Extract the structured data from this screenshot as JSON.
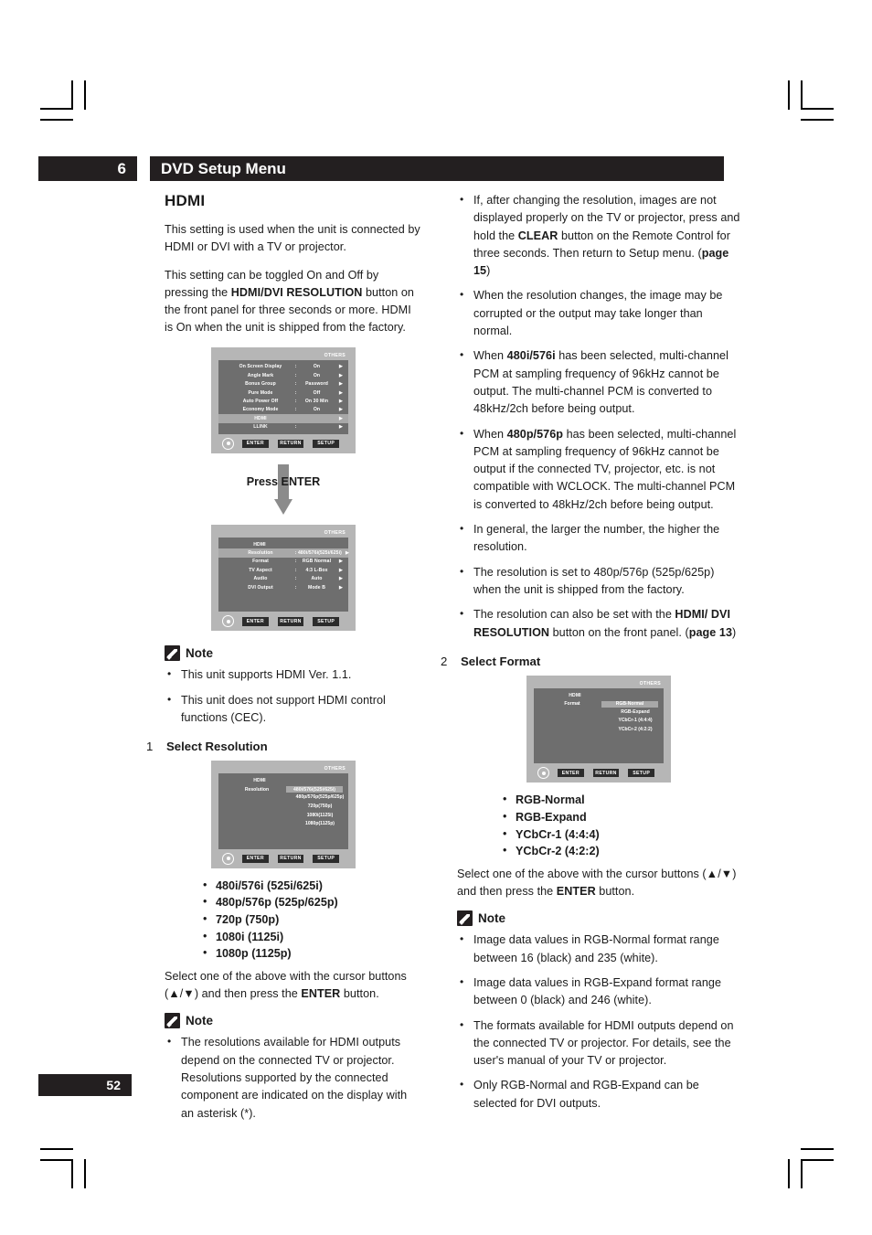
{
  "header": {
    "chapter_number": "6",
    "chapter_title": "DVD Setup Menu"
  },
  "page_number": "52",
  "left_column": {
    "section_title": "HDMI",
    "paragraph_1": "This setting is used when the unit is connected by HDMI or DVI with a TV or projector.",
    "paragraph_2_pre": "This setting can be toggled On and Off by pressing the ",
    "paragraph_2_bold": "HDMI/DVI RESOLUTION",
    "paragraph_2_post": " button on the front panel for three seconds or more. HDMI is On when the unit is shipped from the factory.",
    "osd_others_label": "OTHERS",
    "osd_main": {
      "rows": [
        {
          "label": "On Screen Display",
          "value": "On"
        },
        {
          "label": "Angle Mark",
          "value": "On"
        },
        {
          "label": "Bonus Group",
          "value": "Password"
        },
        {
          "label": "Pure Mode",
          "value": "Off"
        },
        {
          "label": "Auto Power Off",
          "value": "On 30 Min"
        },
        {
          "label": "Economy Mode",
          "value": "On"
        }
      ],
      "selected_row": "HDMI",
      "last_row": {
        "label": "LLINK",
        "value": ""
      },
      "arrow_glyph": "▶"
    },
    "osd_footer": {
      "enter": "ENTER",
      "return": "RETURN",
      "setup": "SETUP"
    },
    "press_enter": "Press ENTER",
    "osd_hdmi": {
      "title": "HDMI",
      "rows": [
        {
          "label": "Resolution",
          "value": "480i/576i(525i/625i)",
          "selected": true
        },
        {
          "label": "Format",
          "value": "RGB Normal",
          "selected": false
        },
        {
          "label": "TV Aspect",
          "value": "4:3 L-Box",
          "selected": false
        },
        {
          "label": "Audio",
          "value": "Auto",
          "selected": false
        },
        {
          "label": "DVI Output",
          "value": "Mode B",
          "selected": false
        }
      ]
    },
    "note_1": {
      "label": "Note",
      "items": [
        "This unit supports HDMI Ver. 1.1.",
        "This unit does not support HDMI control functions (CEC)."
      ]
    },
    "step_1": {
      "number": "1",
      "label_pre": "Select ",
      "label_bold": "Resolution"
    },
    "osd_resolution": {
      "title": "HDMI",
      "field_label": "Resolution",
      "options": [
        "480i/576i(525i/625i)",
        "480p/576p(525p/625p)",
        "720p(750p)",
        "1080i(1125i)",
        "1080p(1125p)"
      ],
      "selected_index": 0
    },
    "resolution_list": [
      "480i/576i (525i/625i)",
      "480p/576p (525p/625p)",
      "720p (750p)",
      "1080i (1125i)",
      "1080p (1125p)"
    ],
    "resolution_instruction_pre": "Select one of the above with the cursor buttons (▲/▼) and then press the ",
    "resolution_instruction_bold": "ENTER",
    "resolution_instruction_post": " button.",
    "note_2": {
      "label": "Note",
      "items": [
        "The resolutions available for HDMI outputs depend on the connected TV or projector. Resolutions supported by the connected component are indicated on the display with an asterisk (*)."
      ]
    }
  },
  "right_column": {
    "bullets_top": [
      {
        "pre": "If, after changing the resolution, images are not displayed properly on the TV or projector, press and hold the ",
        "bold": "CLEAR",
        "mid": " button on the Remote Control for three seconds. Then return to Setup menu. (",
        "bold2": "page 15",
        "post": ")"
      },
      {
        "pre": "When the resolution changes, the image may be corrupted or the output may take longer than normal.",
        "bold": "",
        "mid": "",
        "bold2": "",
        "post": ""
      },
      {
        "pre": "When ",
        "bold": "480i/576i",
        "mid": " has been selected, multi-channel PCM at sampling frequency of 96kHz cannot be output. The multi-channel PCM is converted to 48kHz/2ch before being output.",
        "bold2": "",
        "post": ""
      },
      {
        "pre": "When ",
        "bold": "480p/576p",
        "mid": " has been selected, multi-channel PCM at sampling frequency of 96kHz cannot be output if the connected TV, projector, etc. is not compatible with WCLOCK. The multi-channel PCM is converted to 48kHz/2ch before being output.",
        "bold2": "",
        "post": ""
      },
      {
        "pre": "In general, the larger the number, the higher the resolution.",
        "bold": "",
        "mid": "",
        "bold2": "",
        "post": ""
      },
      {
        "pre": "The resolution is set to 480p/576p (525p/625p) when the unit is shipped from the factory.",
        "bold": "",
        "mid": "",
        "bold2": "",
        "post": ""
      },
      {
        "pre": "The resolution can also be set with the ",
        "bold": "HDMI/ DVI RESOLUTION",
        "mid": " button on the front panel. (",
        "bold2": "page 13",
        "post": ")"
      }
    ],
    "step_2": {
      "number": "2",
      "label_pre": "Select ",
      "label_bold": "Format"
    },
    "osd_format": {
      "others_label": "OTHERS",
      "title": "HDMI",
      "field_label": "Format",
      "options": [
        "RGB-Normal",
        "RGB-Expand",
        "YCbCr-1 (4:4:4)",
        "YCbCr-2 (4:2:2)"
      ],
      "selected_index": 0
    },
    "format_list": [
      "RGB-Normal",
      "RGB-Expand",
      "YCbCr-1 (4:4:4)",
      "YCbCr-2 (4:2:2)"
    ],
    "format_instruction_pre": "Select one of the above with the cursor buttons (▲/▼) and then press the ",
    "format_instruction_bold": "ENTER",
    "format_instruction_post": " button.",
    "note_3": {
      "label": "Note",
      "items": [
        "Image data values in RGB-Normal format range between 16 (black) and 235 (white).",
        "Image data values in RGB-Expand format range between 0 (black) and 246 (white).",
        "The formats available for HDMI outputs depend on the connected TV or projector. For details, see the user's manual of your TV or projector.",
        "Only RGB-Normal and RGB-Expand can be selected for DVI outputs."
      ]
    }
  }
}
